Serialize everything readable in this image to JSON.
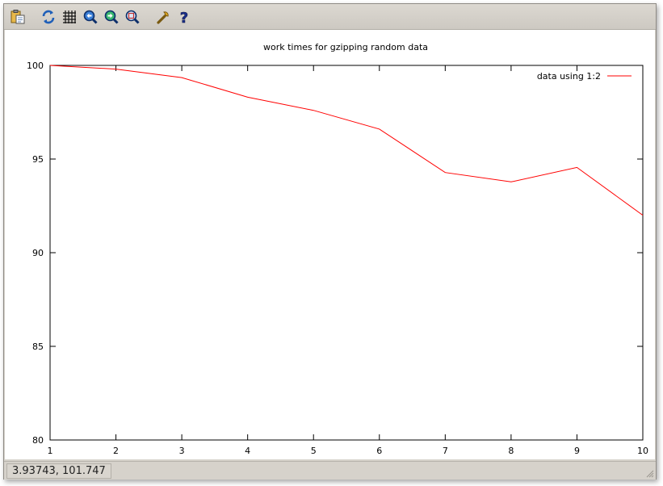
{
  "toolbar": {
    "buttons": [
      {
        "name": "copy-clipboard",
        "icon": "clipboard-icon"
      },
      {
        "name": "replot",
        "icon": "refresh-icon"
      },
      {
        "name": "toggle-grid",
        "icon": "grid-icon"
      },
      {
        "name": "previous-zoom",
        "icon": "zoom-previous-icon"
      },
      {
        "name": "next-zoom",
        "icon": "zoom-next-icon"
      },
      {
        "name": "autoscale",
        "icon": "zoom-autoscale-icon"
      },
      {
        "name": "options",
        "icon": "wrench-icon"
      },
      {
        "name": "help",
        "icon": "help-icon"
      }
    ]
  },
  "status": {
    "coordinates": "3.93743,  101.747"
  },
  "chart_data": {
    "type": "line",
    "title": "work times for gzipping random data",
    "xlabel": "",
    "ylabel": "",
    "xlim": [
      1,
      10
    ],
    "ylim": [
      80,
      100
    ],
    "xticks": [
      "1",
      "2",
      "3",
      "4",
      "5",
      "6",
      "7",
      "8",
      "9",
      "10"
    ],
    "yticks": [
      "80",
      "85",
      "90",
      "95",
      "100"
    ],
    "grid": false,
    "legend_position": "top-right",
    "series": [
      {
        "name": "data using 1:2",
        "color": "#ff0000",
        "x": [
          1,
          2,
          3,
          4,
          5,
          6,
          7,
          8,
          9,
          10
        ],
        "y": [
          100,
          99.8,
          99.35,
          98.3,
          97.6,
          96.6,
          94.28,
          93.78,
          94.55,
          92.0
        ]
      }
    ]
  }
}
